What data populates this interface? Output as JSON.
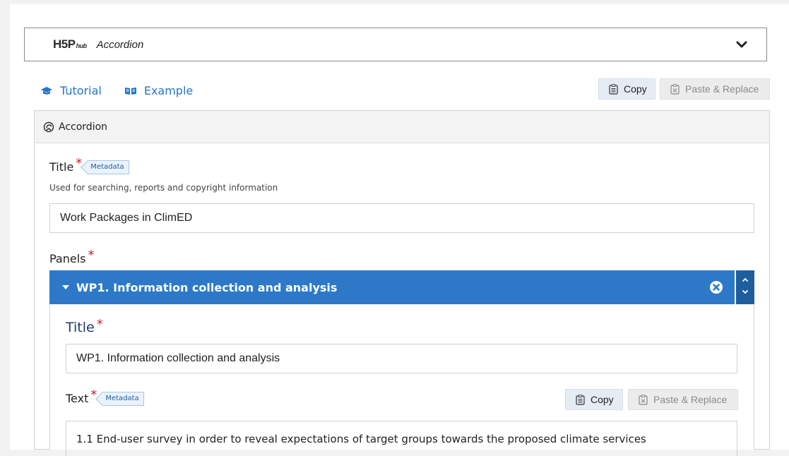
{
  "library": {
    "logo_main": "H5P",
    "logo_sub": "hub",
    "title": "Accordion"
  },
  "links": {
    "tutorial": "Tutorial",
    "example": "Example"
  },
  "clipboard": {
    "copy": "Copy",
    "paste_replace": "Paste & Replace"
  },
  "content_type": {
    "name": "Accordion"
  },
  "title_field": {
    "label": "Title",
    "required_mark": "*",
    "badge": "Metadata",
    "description": "Used for searching, reports and copyright information",
    "value": "Work Packages in ClimED"
  },
  "panels": {
    "label": "Panels",
    "required_mark": "*",
    "items": [
      {
        "header": "WP1. Information collection and analysis",
        "title_label": "Title",
        "title_value": "WP1. Information collection and analysis",
        "text_label": "Text",
        "text_badge": "Metadata",
        "copy": "Copy",
        "paste_replace": "Paste & Replace",
        "text_value": "1.1 End-user survey in order to reveal expectations of target groups towards the proposed climate services"
      }
    ]
  },
  "colors": {
    "accent": "#2d79c8",
    "link": "#2674c9",
    "required": "#c8202a"
  }
}
